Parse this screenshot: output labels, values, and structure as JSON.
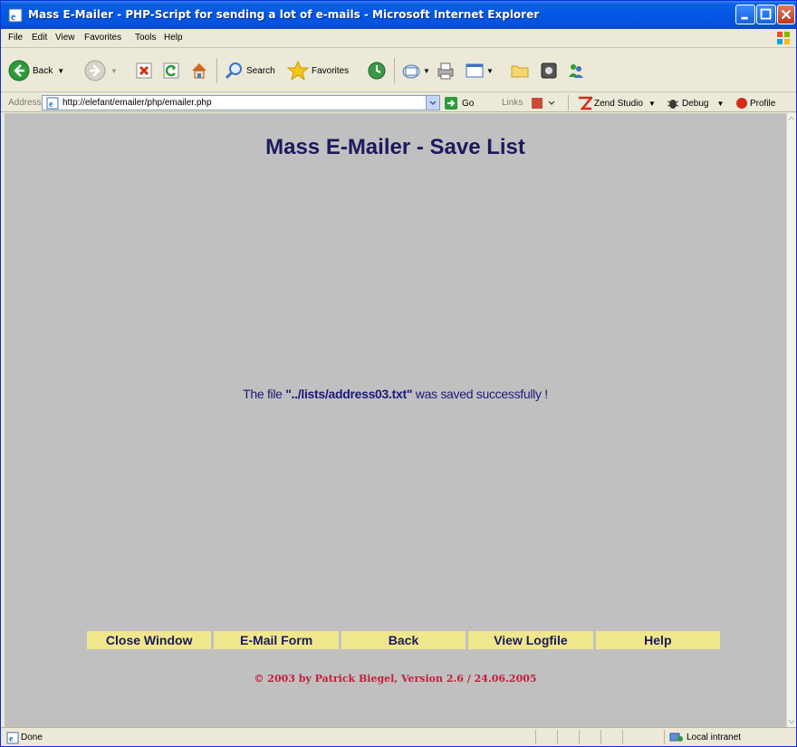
{
  "window": {
    "title": "Mass E-Mailer - PHP-Script for sending a lot of e-mails - Microsoft Internet Explorer"
  },
  "menu": {
    "items": [
      "File",
      "Edit",
      "View",
      "Favorites",
      "Tools",
      "Help"
    ]
  },
  "toolbar": {
    "back_label": "Back",
    "search_label": "Search",
    "favorites_label": "Favorites"
  },
  "address": {
    "label": "Address",
    "url": "http://elefant/emailer/php/emailer.php",
    "go_label": "Go",
    "links_label": "Links",
    "extensions": [
      "Zend Studio",
      "Debug",
      "Profile"
    ]
  },
  "page": {
    "heading": "Mass E-Mailer - Save List",
    "message_prefix": "The file ",
    "message_file": "\"../lists/address03.txt\"",
    "message_suffix": " was saved successfully !",
    "actions": [
      "Close Window",
      "E-Mail Form",
      "Back",
      "View Logfile",
      "Help"
    ],
    "footer": "© 2003 by Patrick Biegel, Version 2.6 / 24.06.2005"
  },
  "status": {
    "text": "Done",
    "zone": "Local intranet"
  },
  "colors": {
    "content_bg": "#c0c0c0",
    "heading": "#1a1a5e",
    "button_bg": "#f0e68c",
    "footer": "#c21f3a",
    "titlebar": "#0058e6"
  }
}
